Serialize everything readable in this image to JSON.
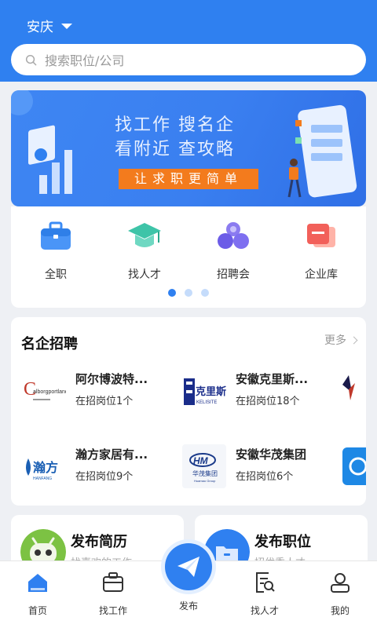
{
  "header": {
    "city": "安庆"
  },
  "search": {
    "placeholder": "搜索职位/公司"
  },
  "banner": {
    "line1": "找工作   搜名企",
    "line2": "看附近   查攻略",
    "tag": "让求职更简单"
  },
  "quick_menu": [
    {
      "label": "全职",
      "icon": "briefcase-icon"
    },
    {
      "label": "找人才",
      "icon": "graduation-cap-icon"
    },
    {
      "label": "招聘会",
      "icon": "people-group-icon"
    },
    {
      "label": "企业库",
      "icon": "company-card-icon"
    }
  ],
  "carousel": {
    "pages": 3,
    "active": 1
  },
  "companies": {
    "title": "名企招聘",
    "more": "更多",
    "items": [
      {
        "name": "阿尔博波特...",
        "jobs": "在招岗位1个",
        "logo_text": "Calborgportland"
      },
      {
        "name": "安徽克里斯...",
        "jobs": "在招岗位18个",
        "logo_text": "克里斯特"
      },
      {
        "name": "瀚方家居有...",
        "jobs": "在招岗位9个",
        "logo_text": "瀚方"
      },
      {
        "name": "安徽华茂集团",
        "jobs": "在招岗位6个",
        "logo_text": "华茂集团"
      }
    ]
  },
  "publish": {
    "resume": {
      "title": "发布简历",
      "sub": "找喜欢的工作"
    },
    "job": {
      "title": "发布职位",
      "sub": "招优秀人才"
    }
  },
  "tabbar": [
    {
      "label": "首页",
      "icon": "home-icon",
      "active": true
    },
    {
      "label": "找工作",
      "icon": "briefcase-icon",
      "active": false
    },
    {
      "label": "发布",
      "icon": "paper-plane-icon",
      "active": false
    },
    {
      "label": "找人才",
      "icon": "search-resume-icon",
      "active": false
    },
    {
      "label": "我的",
      "icon": "user-icon",
      "active": false
    }
  ],
  "colors": {
    "primary": "#2f80f0",
    "accent": "#f37b1d"
  }
}
